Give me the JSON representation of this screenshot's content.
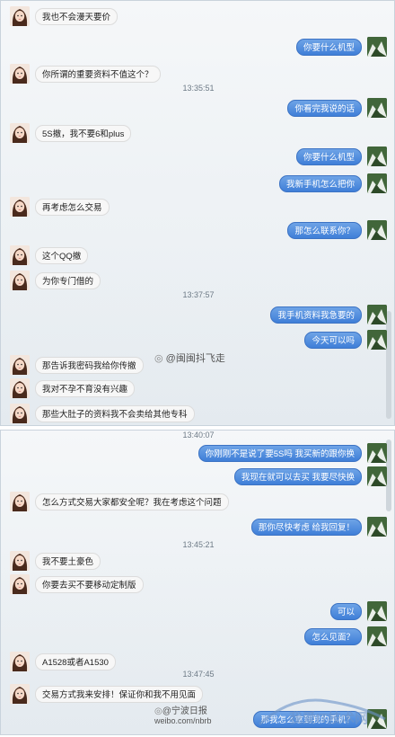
{
  "panel1": {
    "messages": [
      {
        "side": "left",
        "text": "我也不会漫天要价"
      },
      {
        "side": "right",
        "text": "你要什么机型"
      },
      {
        "side": "left",
        "text": "你所谓的重要资料不值这个？"
      },
      {
        "side": "ts",
        "text": "13:35:51"
      },
      {
        "side": "right",
        "text": "你看完我说的话"
      },
      {
        "side": "left",
        "text": "5S撤，我不要6和plus"
      },
      {
        "side": "right",
        "text": "你要什么机型"
      },
      {
        "side": "right",
        "text": "我新手机怎么把你"
      },
      {
        "side": "left",
        "text": "再考虑怎么交易"
      },
      {
        "side": "right",
        "text": "那怎么联系你？"
      },
      {
        "side": "left",
        "text": "这个QQ撤"
      },
      {
        "side": "left",
        "text": "为你专门借的"
      },
      {
        "side": "ts",
        "text": "13:37:57"
      },
      {
        "side": "right",
        "text": "我手机资料我急要的"
      },
      {
        "side": "right",
        "text": "今天可以吗"
      },
      {
        "side": "left",
        "text": "那告诉我密码我给你传撤"
      },
      {
        "side": "left",
        "text": "我对不孕不育没有兴趣"
      },
      {
        "side": "left",
        "text": "那些大肚子的资料我不会卖给其他专科"
      }
    ]
  },
  "panel2": {
    "messages": [
      {
        "side": "ts",
        "text": "13:40:07"
      },
      {
        "side": "right",
        "text": "你刚刚不是说了要5S吗 我买新的跟你换"
      },
      {
        "side": "right",
        "text": "我现在就可以去买 我要尽快换"
      },
      {
        "side": "left",
        "text": "怎么方式交易大家都安全呢？我在考虑这个问题"
      },
      {
        "side": "right",
        "text": "那你尽快考虑 给我回复！"
      },
      {
        "side": "ts",
        "text": "13:45:21"
      },
      {
        "side": "left",
        "text": "我不要土豪色"
      },
      {
        "side": "left",
        "text": "你要去买不要移动定制版"
      },
      {
        "side": "right",
        "text": "可以"
      },
      {
        "side": "right",
        "text": "怎么见面？"
      },
      {
        "side": "left",
        "text": "A1528或者A1530"
      },
      {
        "side": "ts",
        "text": "13:47:45"
      },
      {
        "side": "left",
        "text": "交易方式我来安排！保证你和我不用见面"
      },
      {
        "side": "right",
        "text": "那我怎么拿到我的手机？"
      }
    ]
  },
  "watermarks": {
    "weibo_mid": "@闽闽抖飞走",
    "weibo_bottom": "@宁波日报",
    "weibo_url": "weibo.com/nbrb",
    "site_logo": "我爱IT技术网"
  }
}
